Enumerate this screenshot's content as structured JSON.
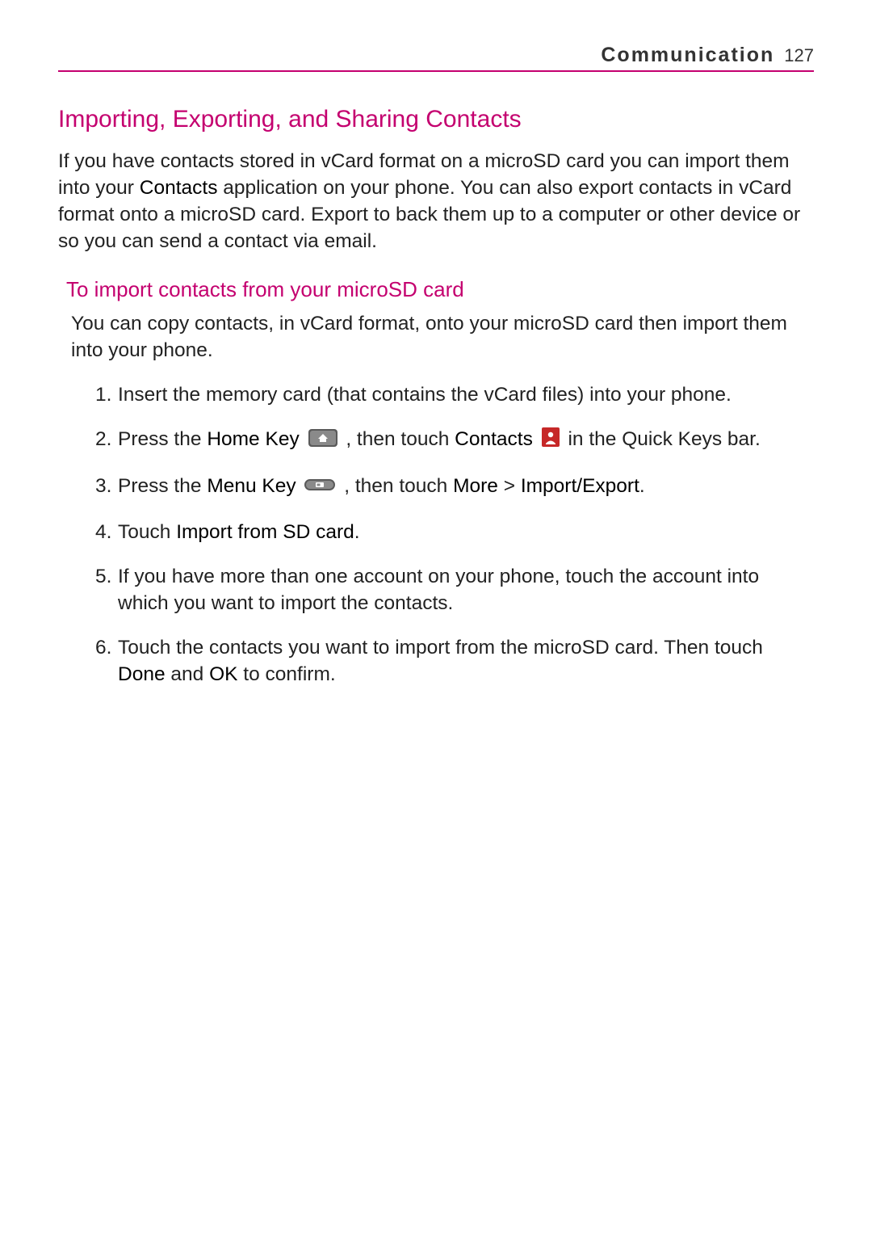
{
  "header": {
    "section": "Communication",
    "page_number": "127"
  },
  "main_heading": "Importing, Exporting, and Sharing Contacts",
  "intro_p1": "If you have contacts stored in vCard format on a microSD card you can import them into your ",
  "intro_term_contacts": "Contacts",
  "intro_p2": " application on your phone. You can also export contacts in vCard format onto a microSD card. Export to back them up to a computer or other device or so you can send a contact via email.",
  "sub_heading": "To import contacts from your microSD card",
  "sub_intro": "You can copy contacts, in vCard format, onto your microSD card then import them into your phone.",
  "steps": {
    "s1": "Insert the memory card (that contains the vCard files) into your phone.",
    "s2a": "Press the ",
    "s2_home_key": "Home Key",
    "s2b": " , then touch ",
    "s2_contacts": "Contacts",
    "s2c": " in the Quick Keys bar.",
    "s3a": "Press the ",
    "s3_menu_key": "Menu Key",
    "s3b": " , then touch ",
    "s3_more": "More",
    "s3c": " > ",
    "s3_import_export": "Import/Export",
    "s3d": ".",
    "s4a": "Touch ",
    "s4_import": "Import from SD card",
    "s4b": ".",
    "s5": "If you have more than one account on your phone, touch the account into which you want to import the contacts.",
    "s6a": "Touch the contacts you want to import from the microSD card. Then touch ",
    "s6_done": "Done",
    "s6b": " and ",
    "s6_ok": "OK",
    "s6c": " to confirm."
  }
}
